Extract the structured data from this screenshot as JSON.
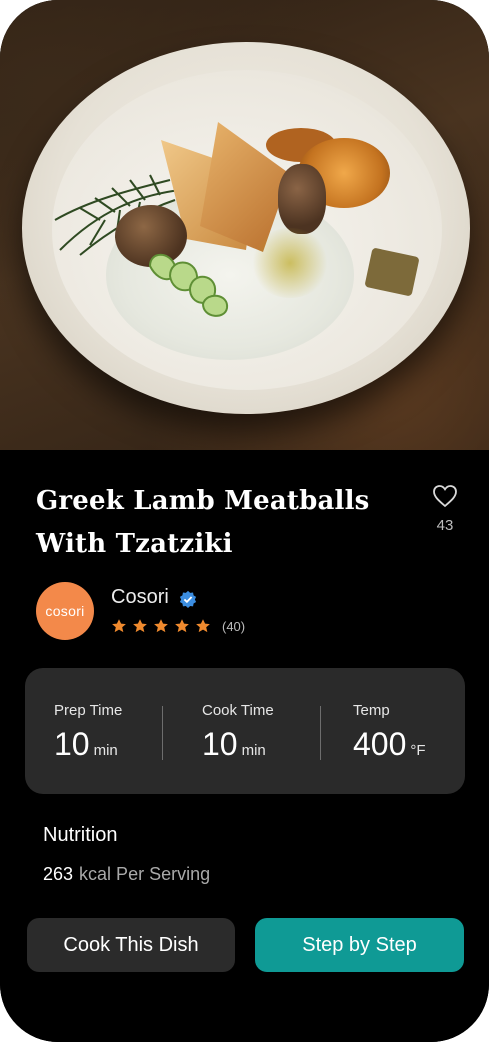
{
  "recipe": {
    "title_line1": "Greek Lamb Meatballs",
    "title_line2": "With Tzatziki",
    "likes": "43"
  },
  "author": {
    "name": "Cosori",
    "avatar_text": "cosori",
    "rating_stars": 5,
    "rating_count": "(40)",
    "verified": true
  },
  "stats": [
    {
      "label": "Prep Time",
      "value": "10",
      "unit": "min"
    },
    {
      "label": "Cook Time",
      "value": "10",
      "unit": "min"
    },
    {
      "label": "Temp",
      "value": "400",
      "unit": "°F"
    }
  ],
  "nutrition": {
    "title": "Nutrition",
    "kcal": "263",
    "kcal_label": "kcal Per Serving"
  },
  "buttons": {
    "cook_label": "Cook This Dish",
    "step_label": "Step by Step"
  },
  "colors": {
    "accent": "#0f9a95",
    "avatar": "#f3894a",
    "star": "#f08a2e",
    "verified": "#3b8de0"
  },
  "icons": {
    "like": "heart-outline-icon",
    "verified": "verified-badge-icon",
    "star": "star-icon"
  }
}
